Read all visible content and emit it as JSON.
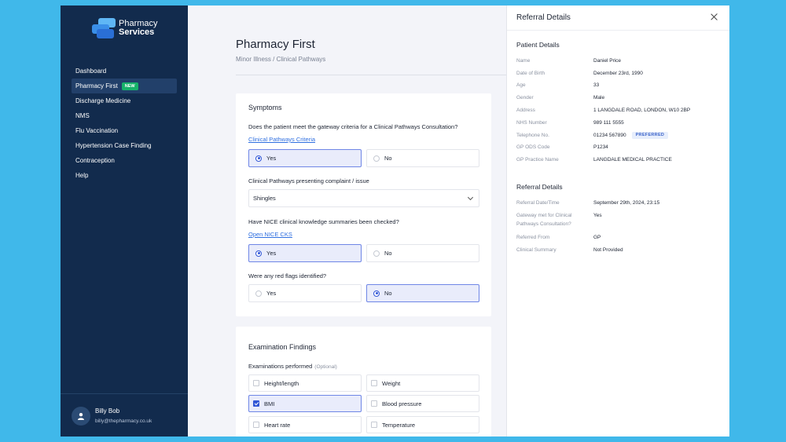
{
  "brand": {
    "line1": "Pharmacy",
    "line2": "Services"
  },
  "nav": {
    "items": [
      {
        "label": "Dashboard"
      },
      {
        "label": "Pharmacy First",
        "badge": "NEW",
        "active": true
      },
      {
        "label": "Discharge Medicine"
      },
      {
        "label": "NMS"
      },
      {
        "label": "Flu Vaccination"
      },
      {
        "label": "Hypertension Case Finding"
      },
      {
        "label": "Contraception"
      },
      {
        "label": "Help"
      }
    ]
  },
  "user": {
    "name": "Billy Bob",
    "email": "billy@thepharmacy.co.uk"
  },
  "page": {
    "title": "Pharmacy First",
    "breadcrumb": "Minor Illness / Clinical Pathways"
  },
  "symptoms": {
    "title": "Symptoms",
    "q1": "Does the patient meet the gateway criteria for a Clinical Pathways Consultation?",
    "q1_link": "Clinical Pathways Criteria",
    "q1_yes": "Yes",
    "q1_no": "No",
    "q1_selected": "Yes",
    "q2": "Clinical Pathways presenting complaint / issue",
    "q2_value": "Shingles",
    "q3": "Have NICE clinical knowledge summaries been checked?",
    "q3_link": "Open NICE CKS",
    "q3_yes": "Yes",
    "q3_no": "No",
    "q3_selected": "Yes",
    "q4": "Were any red flags identified?",
    "q4_yes": "Yes",
    "q4_no": "No",
    "q4_selected": "No"
  },
  "exam": {
    "title": "Examination Findings",
    "label": "Examinations performed",
    "optional": "(Optional)",
    "options": [
      {
        "label": "Height/length",
        "checked": false
      },
      {
        "label": "Weight",
        "checked": false
      },
      {
        "label": "BMI",
        "checked": true
      },
      {
        "label": "Blood pressure",
        "checked": false
      },
      {
        "label": "Heart rate",
        "checked": false
      },
      {
        "label": "Temperature",
        "checked": false
      }
    ]
  },
  "panel": {
    "title": "Referral Details",
    "patient_title": "Patient Details",
    "patient": [
      {
        "k": "Name",
        "v": "Daniel Price"
      },
      {
        "k": "Date of Birth",
        "v": "December 23rd, 1990"
      },
      {
        "k": "Age",
        "v": "33"
      },
      {
        "k": "Gender",
        "v": "Male"
      },
      {
        "k": "Address",
        "v": "1 LANGDALE ROAD, LONDON, W10 2BP"
      },
      {
        "k": "NHS Number",
        "v": "989 111 5555"
      },
      {
        "k": "Telephone No.",
        "v": "01234 567890",
        "badge": "PREFERRED"
      },
      {
        "k": "GP ODS Code",
        "v": "P1234"
      },
      {
        "k": "GP Practice Name",
        "v": "LANGDALE MEDICAL PRACTICE"
      }
    ],
    "referral_title": "Referral Details",
    "referral": [
      {
        "k": "Referral Date/Time",
        "v": "September 29th, 2024, 23:15"
      },
      {
        "k": "Gateway met for Clinical Pathways Consultation?",
        "v": "Yes"
      },
      {
        "k": "Referred From",
        "v": "GP"
      },
      {
        "k": "Clinical Summary",
        "v": "Not Provided"
      }
    ]
  },
  "colors": {
    "sidebar": "#122b4d",
    "accent": "#3156d6",
    "badge_new": "#17b26a",
    "frame": "#40b8ea"
  }
}
